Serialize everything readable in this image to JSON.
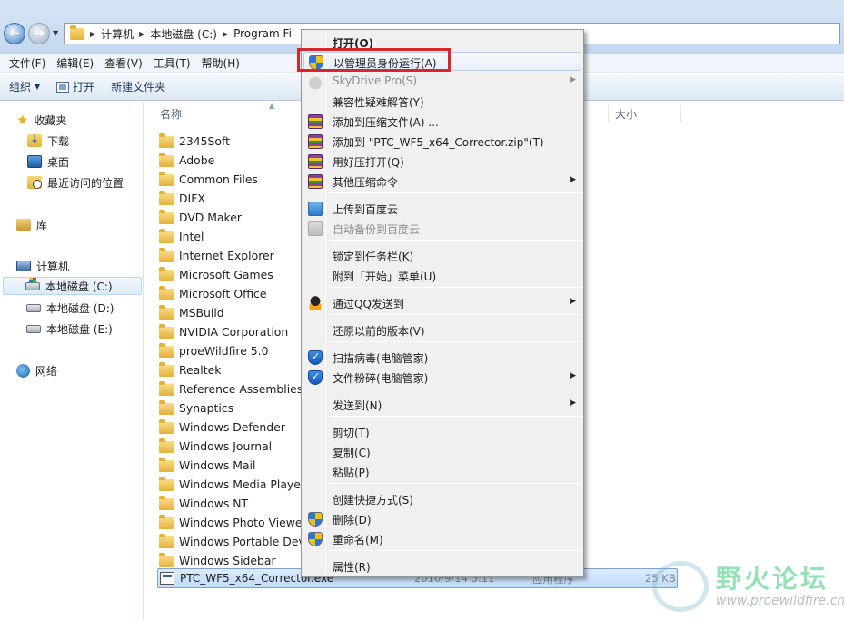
{
  "address": {
    "crumbs": [
      "计算机",
      "本地磁盘 (C:)",
      "Program Fi"
    ]
  },
  "menubar": [
    "文件(F)",
    "编辑(E)",
    "查看(V)",
    "工具(T)",
    "帮助(H)"
  ],
  "toolbar": {
    "organize": "组织",
    "open": "打开",
    "new_folder": "新建文件夹"
  },
  "navpane": {
    "favorites": "收藏夹",
    "downloads": "下载",
    "desktop": "桌面",
    "recent": "最近访问的位置",
    "libraries": "库",
    "computer": "计算机",
    "drive_c": "本地磁盘 (C:)",
    "drive_d": "本地磁盘 (D:)",
    "drive_e": "本地磁盘 (E:)",
    "network": "网络"
  },
  "filelist": {
    "col_name": "名称",
    "col_size": "大小",
    "folders": [
      "2345Soft",
      "Adobe",
      "Common Files",
      "DIFX",
      "DVD Maker",
      "Intel",
      "Internet Explorer",
      "Microsoft Games",
      "Microsoft Office",
      "MSBuild",
      "NVIDIA Corporation",
      "proeWildfire 5.0",
      "Realtek",
      "Reference Assemblies",
      "Synaptics",
      "Windows Defender",
      "Windows Journal",
      "Windows Mail",
      "Windows Media Player",
      "Windows NT",
      "Windows Photo Viewer",
      "Windows Portable Devi",
      "Windows Sidebar"
    ],
    "selected_file": {
      "name": "PTC_WF5_x64_Corrector.exe",
      "date": "2010/9/14 5:11",
      "type": "应用程序",
      "size": "25 KB"
    }
  },
  "context_menu": {
    "items": [
      {
        "label": "打开(O)"
      },
      {
        "label": "以管理员身份运行(A)"
      },
      {
        "label": "SkyDrive Pro(S)"
      },
      {
        "label": "兼容性疑难解答(Y)"
      },
      {
        "label": "添加到压缩文件(A) ..."
      },
      {
        "label": "添加到 \"PTC_WF5_x64_Corrector.zip\"(T)"
      },
      {
        "label": "用好压打开(Q)"
      },
      {
        "label": "其他压缩命令"
      },
      {
        "label": "上传到百度云"
      },
      {
        "label": "自动备份到百度云"
      },
      {
        "label": "锁定到任务栏(K)"
      },
      {
        "label": "附到「开始」菜单(U)"
      },
      {
        "label": "通过QQ发送到"
      },
      {
        "label": "还原以前的版本(V)"
      },
      {
        "label": "扫描病毒(电脑管家)"
      },
      {
        "label": "文件粉碎(电脑管家)"
      },
      {
        "label": "发送到(N)"
      },
      {
        "label": "剪切(T)"
      },
      {
        "label": "复制(C)"
      },
      {
        "label": "粘贴(P)"
      },
      {
        "label": "创建快捷方式(S)"
      },
      {
        "label": "删除(D)"
      },
      {
        "label": "重命名(M)"
      },
      {
        "label": "属性(R)"
      }
    ]
  },
  "watermark": {
    "title": "野火论坛",
    "url": "www.proewildfire.cn"
  },
  "colors": {
    "highlight_box": "#d9262b",
    "selection": "#c1dcfc",
    "menu_bg": "#f0f0f0"
  }
}
